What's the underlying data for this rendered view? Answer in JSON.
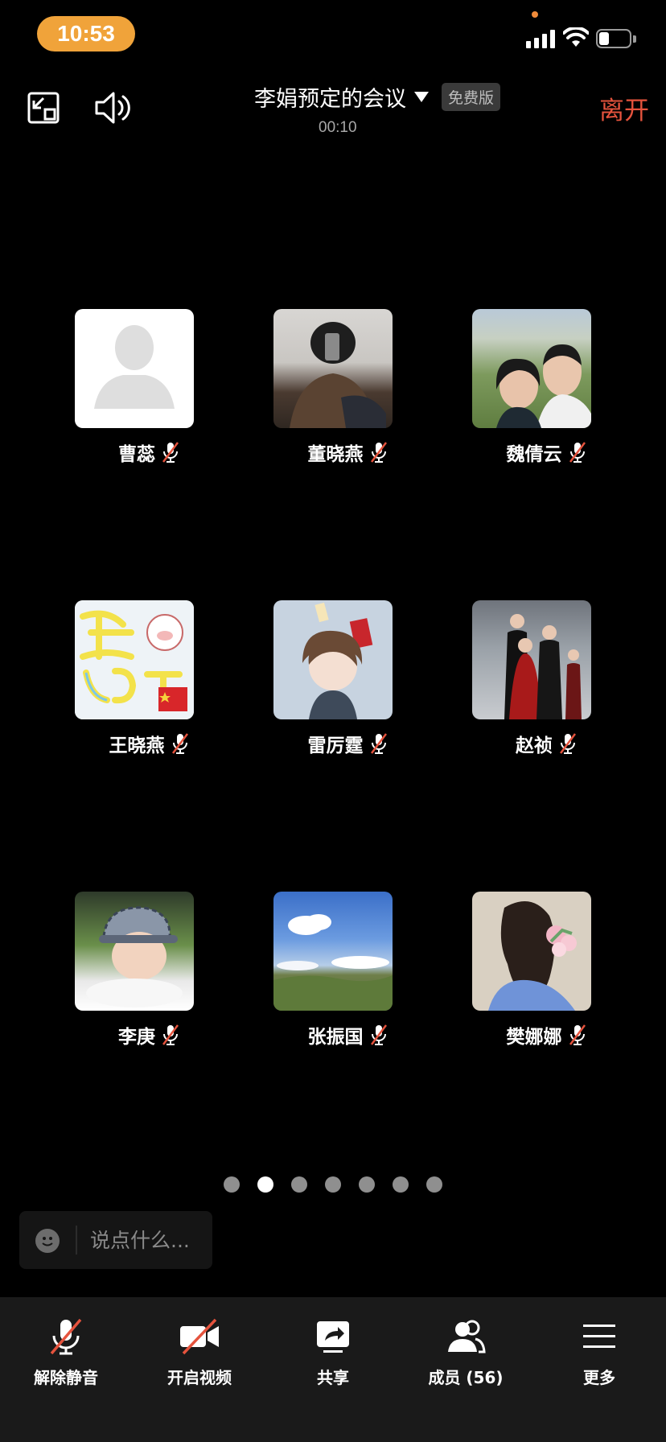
{
  "status_bar": {
    "time": "10:53"
  },
  "header": {
    "meeting_title": "李娟预定的会议",
    "plan_badge": "免费版",
    "duration": "00:10",
    "leave_label": "离开"
  },
  "participants": [
    {
      "name": "曹蕊",
      "muted": true,
      "avatar": "default-person-icon"
    },
    {
      "name": "董晓燕",
      "muted": true,
      "avatar": "photo"
    },
    {
      "name": "魏倩云",
      "muted": true,
      "avatar": "photo"
    },
    {
      "name": "王晓燕",
      "muted": true,
      "avatar": "photo"
    },
    {
      "name": "雷厉霆",
      "muted": true,
      "avatar": "cartoon"
    },
    {
      "name": "赵祯",
      "muted": true,
      "avatar": "photo"
    },
    {
      "name": "李庚",
      "muted": true,
      "avatar": "photo"
    },
    {
      "name": "张振国",
      "muted": true,
      "avatar": "photo"
    },
    {
      "name": "樊娜娜",
      "muted": true,
      "avatar": "illustration"
    }
  ],
  "pagination": {
    "total": 7,
    "current": 2
  },
  "chat": {
    "placeholder": "说点什么..."
  },
  "toolbar": {
    "unmute_label": "解除静音",
    "video_label": "开启视频",
    "share_label": "共享",
    "members_label": "成员 (56)",
    "more_label": "更多"
  },
  "colors": {
    "accent": "#f0a33a",
    "leave": "#e5533d",
    "mute_slash": "#e5533d"
  }
}
